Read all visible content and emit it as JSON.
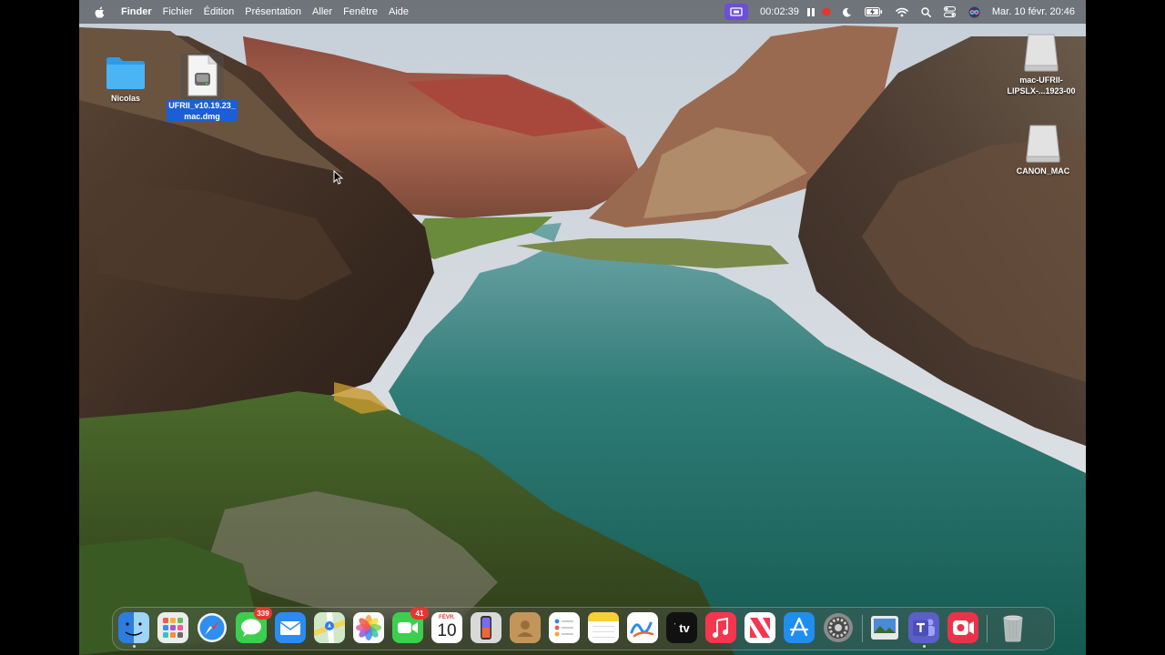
{
  "menubar": {
    "app_name": "Finder",
    "menus": [
      "Fichier",
      "Édition",
      "Présentation",
      "Aller",
      "Fenêtre",
      "Aide"
    ],
    "timer": "00:02:39",
    "datetime": "Mar. 10 févr. 20:46"
  },
  "desktop": {
    "icons": [
      {
        "label": "Nicolas",
        "kind": "folder"
      },
      {
        "label_line1": "UFRII_v10.19.23_",
        "label_line2": "mac.dmg",
        "kind": "disk-image",
        "selected": true
      },
      {
        "label_line1": "mac-UFRII-",
        "label_line2": "LIPSLX-...1923-00",
        "kind": "external-drive"
      },
      {
        "label": "CANON_MAC",
        "kind": "external-drive"
      }
    ]
  },
  "dock": {
    "apps": [
      {
        "name": "Finder",
        "running": true
      },
      {
        "name": "Launchpad"
      },
      {
        "name": "Safari"
      },
      {
        "name": "Messages",
        "badge": "339"
      },
      {
        "name": "Mail"
      },
      {
        "name": "Plans"
      },
      {
        "name": "Photos"
      },
      {
        "name": "FaceTime",
        "badge": "41"
      },
      {
        "name": "Calendrier",
        "month": "FÉVR.",
        "day": "10"
      },
      {
        "name": "iPhone Mirroring"
      },
      {
        "name": "Contacts"
      },
      {
        "name": "Rappels"
      },
      {
        "name": "Notes"
      },
      {
        "name": "Freeform"
      },
      {
        "name": "Apple TV",
        "label": "tv"
      },
      {
        "name": "Musique"
      },
      {
        "name": "News"
      },
      {
        "name": "App Store"
      },
      {
        "name": "Réglages Système"
      },
      {
        "name": "Aperçu"
      },
      {
        "name": "Microsoft Teams",
        "running": true
      },
      {
        "name": "Screen Recorder"
      },
      {
        "name": "Corbeille"
      }
    ]
  },
  "colors": {
    "menubar_bg": "#2a2c30",
    "selection": "#1a5fd6",
    "badge": "#e5372f",
    "record_pill": "#6b4fd8"
  }
}
